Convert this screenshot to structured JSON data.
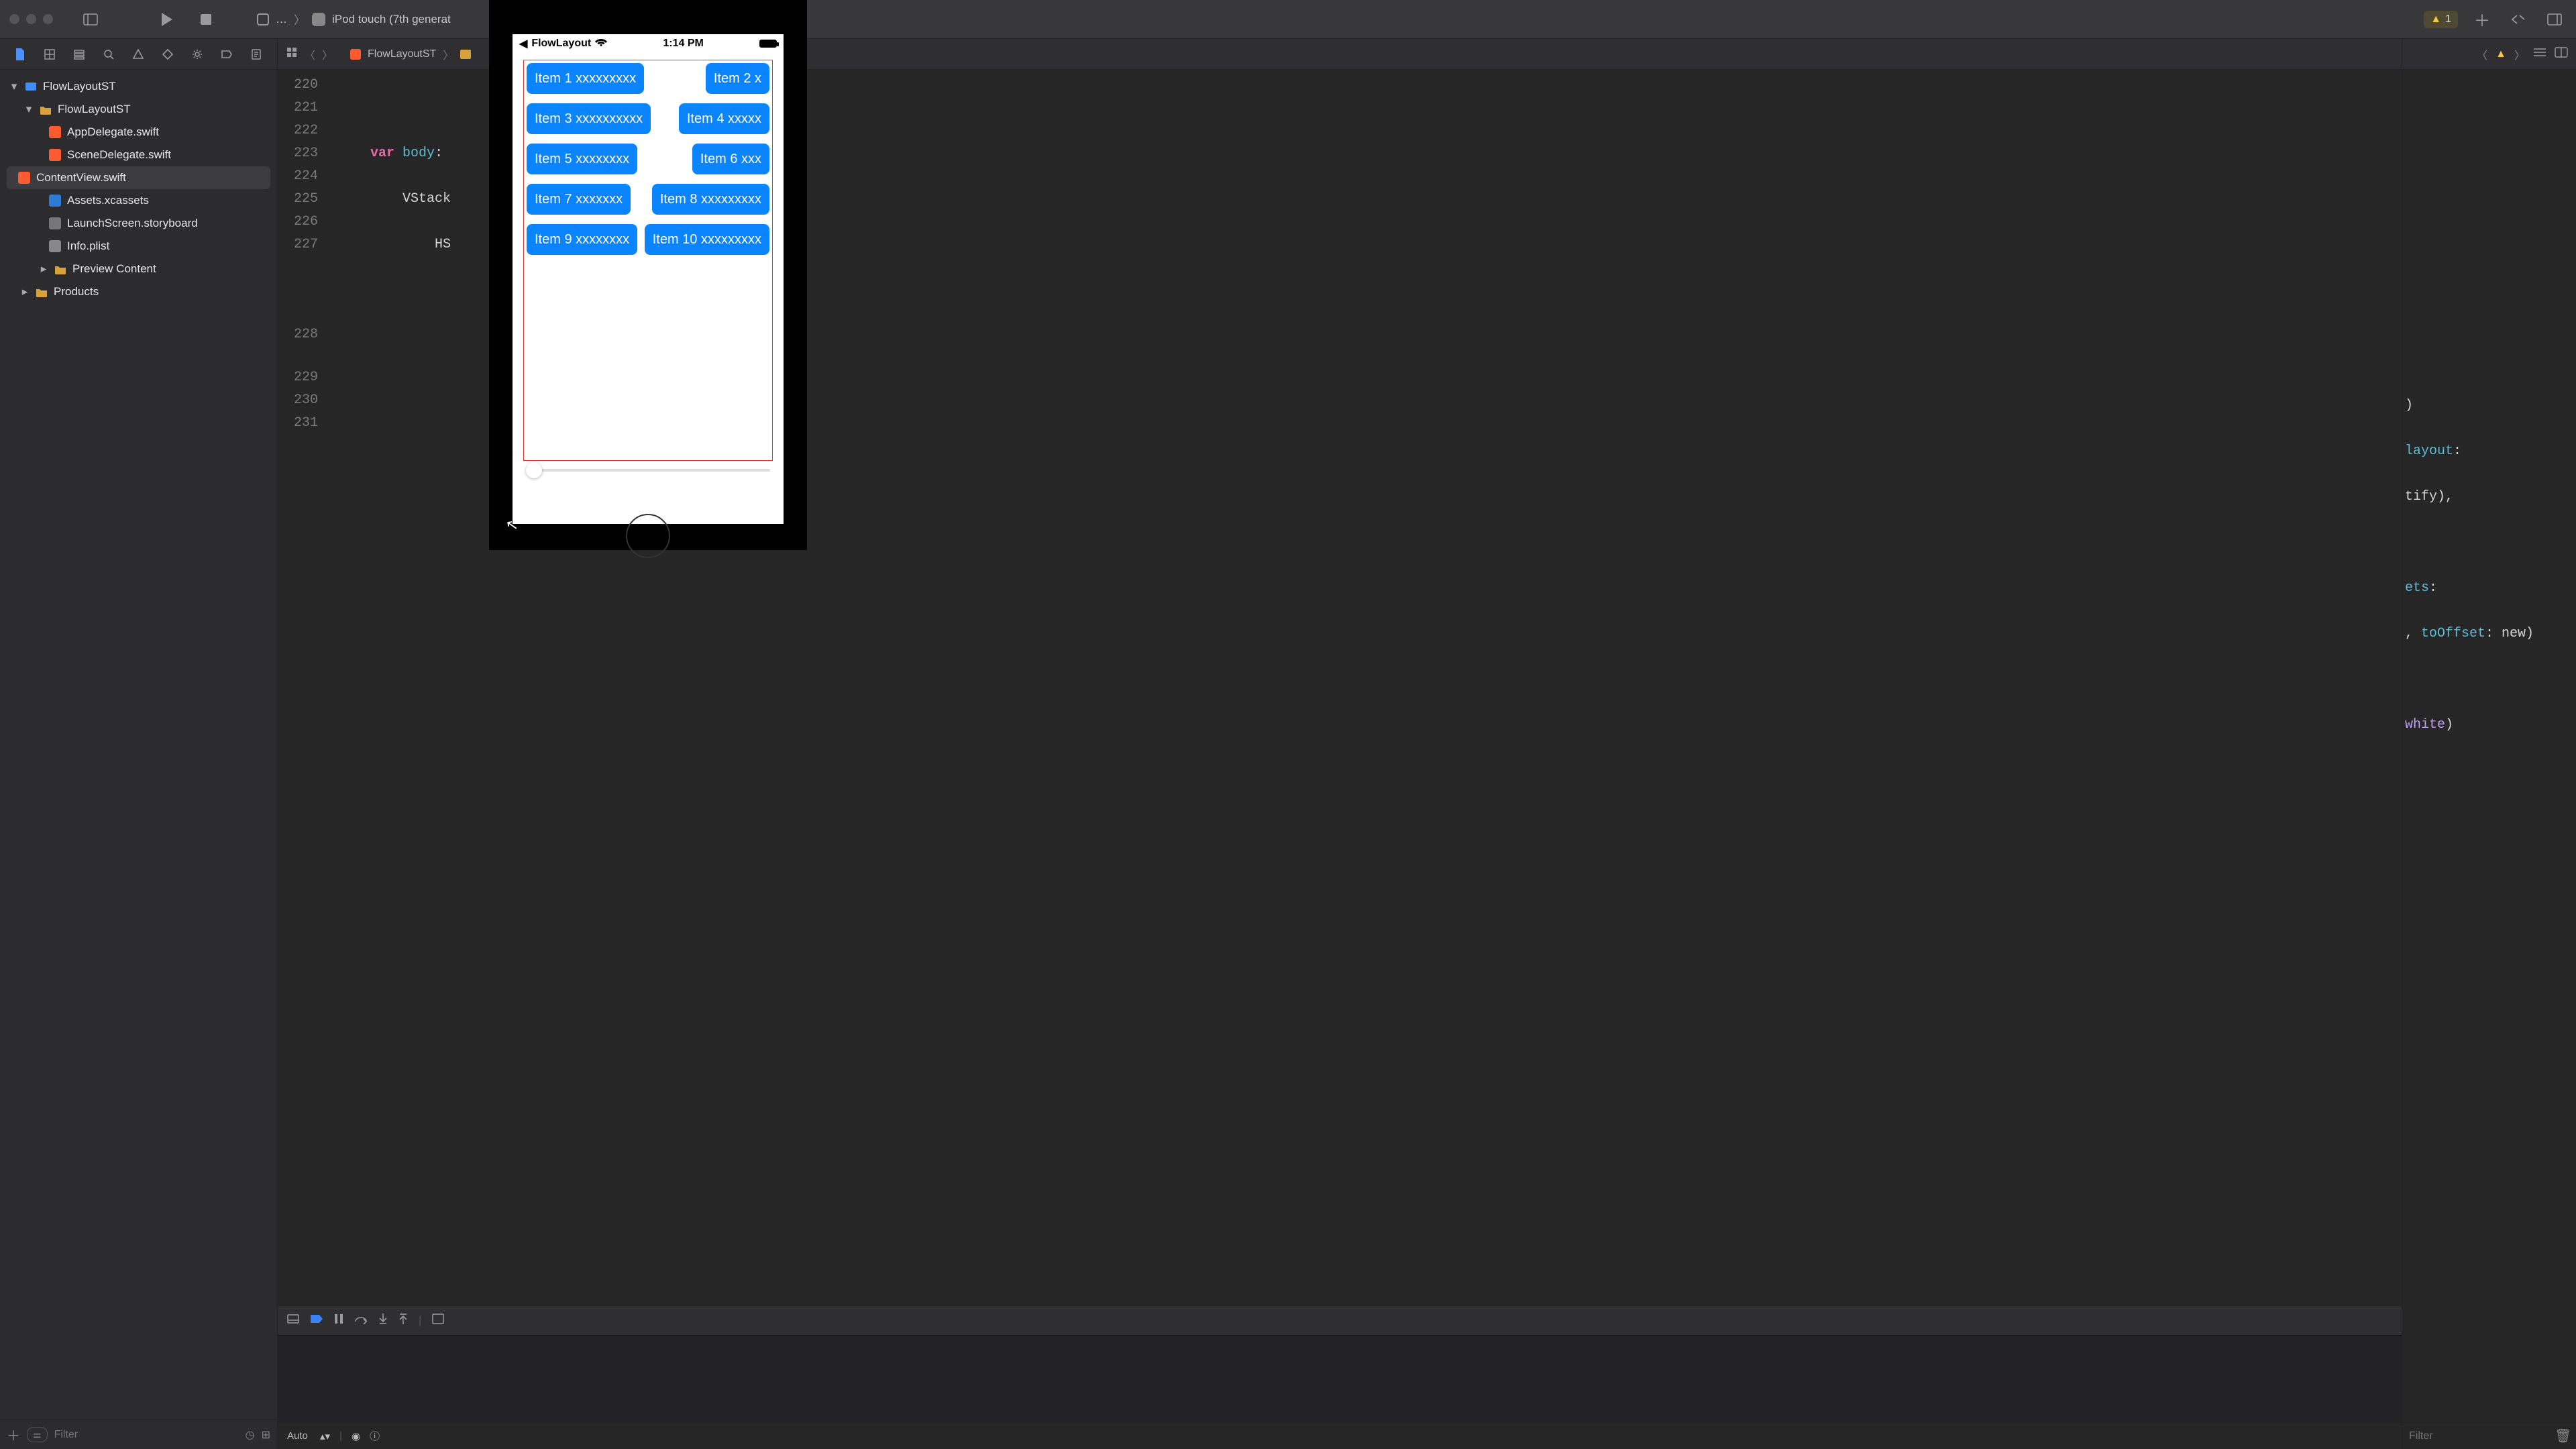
{
  "titlebar": {
    "scheme_more": "…",
    "device": "iPod touch (7th generat",
    "warning_count": "1"
  },
  "subbar": {
    "crumb_file": "FlowLayoutST"
  },
  "navigator": {
    "root": "FlowLayoutST",
    "group": "FlowLayoutST",
    "files": {
      "appdelegate": "AppDelegate.swift",
      "scenedelegate": "SceneDelegate.swift",
      "contentview": "ContentView.swift",
      "assets": "Assets.xcassets",
      "launchscreen": "LaunchScreen.storyboard",
      "infoplist": "Info.plist",
      "preview": "Preview Content"
    },
    "products": "Products",
    "filter_placeholder": "Filter"
  },
  "editor": {
    "lines": {
      "l220": "220",
      "l221": "221",
      "l222": "222",
      "l223": "223",
      "l224": "224",
      "l225": "225",
      "l226": "226",
      "l227": "227",
      "l228": "228",
      "l229": "229",
      "l230": "230",
      "l231": "231"
    },
    "code": {
      "var": "var",
      "body": "body",
      "colon": ":",
      "vstack": "VStack",
      "hs": "HS"
    },
    "footer_auto": "Auto"
  },
  "rightpane": {
    "r1": ")",
    "r2a": "layout",
    "r2b": ":",
    "r3": "tify),",
    "r4a": "ets",
    "r4b": ":",
    "r5a": ", ",
    "r5b": "toOffset",
    "r5c": ": new)",
    "r6a": "white",
    "r6b": ")",
    "filter_placeholder": "Filter"
  },
  "simulator": {
    "back_app": "FlowLayout",
    "time": "1:14 PM",
    "chips": {
      "c1": "Item 1 xxxxxxxxx",
      "c2": "Item 2 x",
      "c3": "Item 3 xxxxxxxxxx",
      "c4": "Item 4 xxxxx",
      "c5": "Item 5 xxxxxxxx",
      "c6": "Item 6 xxx",
      "c7": "Item 7 xxxxxxx",
      "c8": "Item 8 xxxxxxxxx",
      "c9": "Item 9 xxxxxxxx",
      "c10": "Item 10 xxxxxxxxx"
    }
  }
}
